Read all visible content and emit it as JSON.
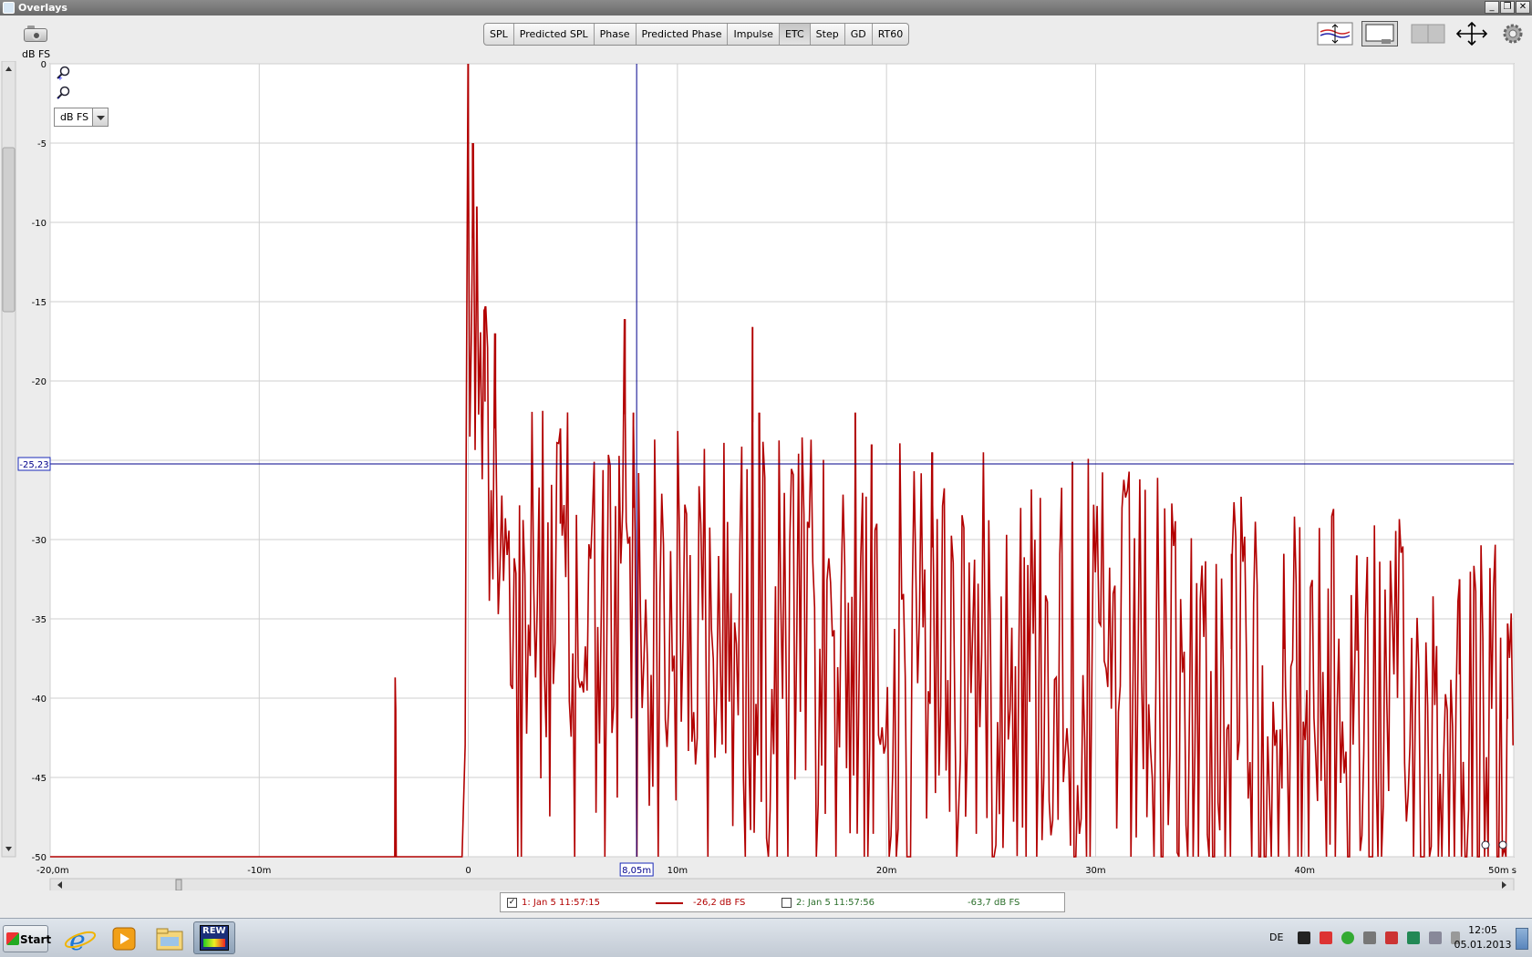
{
  "window": {
    "title": "Overlays"
  },
  "toolbar": {
    "unit_label": "dB FS",
    "tabs": [
      "SPL",
      "Predicted SPL",
      "Phase",
      "Predicted Phase",
      "Impulse",
      "ETC",
      "Step",
      "GD",
      "RT60"
    ],
    "active_tab": "ETC"
  },
  "unit_select": {
    "value": "dB FS"
  },
  "cursor": {
    "x_label": "8,05m",
    "y_label": "-25,23"
  },
  "chart_data": {
    "type": "line",
    "title": "",
    "xlabel": "",
    "ylabel": "dB FS",
    "xlim": [
      -20,
      50
    ],
    "ylim": [
      -50,
      0
    ],
    "x_ticks": [
      -20,
      -10,
      0,
      10,
      20,
      30,
      40,
      50
    ],
    "x_tick_labels": [
      "-20,0m",
      "-10m",
      "0",
      "10m",
      "20m",
      "30m",
      "40m",
      "50m s"
    ],
    "y_ticks": [
      0,
      -5,
      -10,
      -15,
      -20,
      -25,
      -30,
      -35,
      -40,
      -45,
      -50
    ],
    "y_tick_labels": [
      "0",
      "-5",
      "-10",
      "-15",
      "-20",
      "-25",
      "-30",
      "-35",
      "-40",
      "-45",
      "-50"
    ],
    "grid": true,
    "cursor_x": 8.05,
    "cursor_y": -25.23,
    "series": [
      {
        "name": "1: Jan 5 11:57:15",
        "color": "#b20000",
        "peaks": [
          {
            "x": -3.5,
            "y": -38.7
          },
          {
            "x": 0.0,
            "y": 0.0
          },
          {
            "x": 0.2,
            "y": -5
          },
          {
            "x": 0.4,
            "y": -9
          },
          {
            "x": 0.8,
            "y": -15.3
          },
          {
            "x": 1.3,
            "y": -17
          },
          {
            "x": 4.4,
            "y": -23
          },
          {
            "x": 7.5,
            "y": -16.1
          },
          {
            "x": 7.9,
            "y": -22
          },
          {
            "x": 13.6,
            "y": -16.6
          },
          {
            "x": 13.9,
            "y": -22
          },
          {
            "x": 18.5,
            "y": -22
          },
          {
            "x": 19.3,
            "y": -24
          },
          {
            "x": 22.2,
            "y": -24.5
          },
          {
            "x": 28.9,
            "y": -25.1
          },
          {
            "x": 36.5,
            "y": -30.9
          },
          {
            "x": 39.0,
            "y": -30.9
          },
          {
            "x": 42.5,
            "y": -31
          },
          {
            "x": 47.4,
            "y": -32.5
          },
          {
            "x": 49.7,
            "y": -35.3
          }
        ]
      },
      {
        "name": "2: Jan 5 11:57:56",
        "color": "#2a6e2a",
        "visible": false
      }
    ]
  },
  "legend": {
    "items": [
      {
        "checked": true,
        "label": "1: Jan 5 11:57:15",
        "value": "-26,2 dB FS",
        "color": "#b20000"
      },
      {
        "checked": false,
        "label": "2: Jan 5 11:57:56",
        "value": "-63,7 dB FS",
        "color": "#2a6e2a"
      }
    ]
  },
  "taskbar": {
    "start_label": "Start",
    "apps": [
      "ie-icon",
      "media-player-icon",
      "explorer-icon",
      "rew-icon"
    ],
    "rew_label": "REW",
    "language": "DE",
    "time": "12:05",
    "date": "05.01.2013"
  }
}
